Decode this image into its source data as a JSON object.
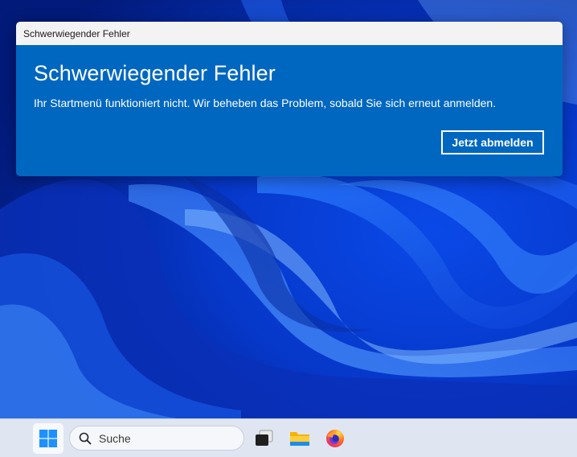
{
  "dialog": {
    "window_title": "Schwerwiegender Fehler",
    "heading": "Schwerwiegender Fehler",
    "message": "Ihr Startmenü funktioniert nicht. Wir beheben das Problem, sobald Sie sich erneut anmelden.",
    "button_label": "Jetzt abmelden",
    "accent_color": "#0067c0"
  },
  "taskbar": {
    "search_placeholder": "Suche",
    "icons": [
      "windows-start-icon",
      "search-icon",
      "task-view-icon",
      "file-explorer-icon",
      "firefox-icon"
    ]
  }
}
